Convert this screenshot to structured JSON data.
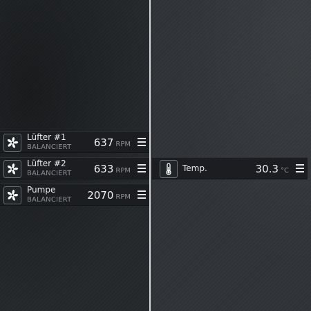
{
  "left_panel": {
    "tiles": [
      {
        "title": "Lüfter #1",
        "subtitle": "BALANCIERT",
        "value": "637",
        "unit": "RPM",
        "icon": "fan-icon"
      },
      {
        "title": "Lüfter #2",
        "subtitle": "BALANCIERT",
        "value": "633",
        "unit": "RPM",
        "icon": "fan-icon"
      },
      {
        "title": "Pumpe",
        "subtitle": "BALANCIERT",
        "value": "2070",
        "unit": "RPM",
        "icon": "fan-icon"
      }
    ]
  },
  "right_panel": {
    "tiles": [
      {
        "title": "Temp.",
        "value": "30.3",
        "unit": "°C",
        "icon": "thermometer-icon"
      }
    ]
  },
  "colors": {
    "tile_background": "#1b1d20",
    "divider": "#d8dadc",
    "text_primary": "#e6e8ea",
    "text_secondary": "#8c9095"
  }
}
